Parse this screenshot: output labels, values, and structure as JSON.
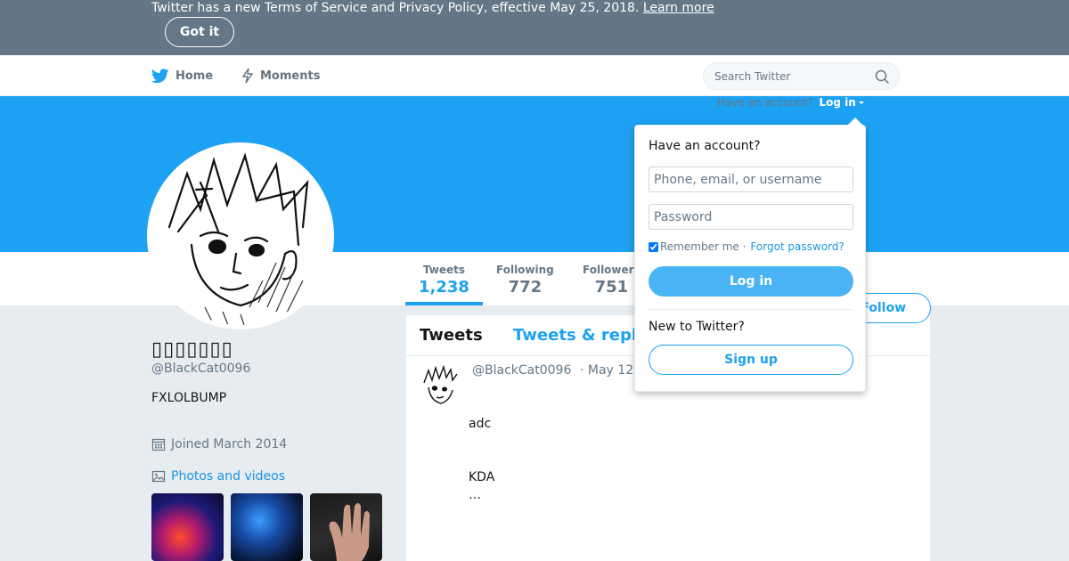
{
  "banner": {
    "text": "Twitter has a new Terms of Service and Privacy Policy, effective May 25, 2018.",
    "link": "Learn more",
    "button": "Got it"
  },
  "nav": {
    "home": "Home",
    "moments": "Moments",
    "search_placeholder": "Search Twitter"
  },
  "header": {
    "have_account": "Have an account?",
    "login_link": "Log in"
  },
  "stats": [
    {
      "label": "Tweets",
      "value": "1,238"
    },
    {
      "label": "Following",
      "value": "772"
    },
    {
      "label": "Followers",
      "value": "751"
    }
  ],
  "follow_button": "Follow",
  "profile": {
    "name": "▯▯▯▯▯▯▯",
    "handle": "@BlackCat0096",
    "bio": "FXLOLBUMP",
    "joined": "Joined March 2014",
    "photos_link": "Photos and videos"
  },
  "timeline": {
    "tab_tweets": "Tweets",
    "tab_replies": "Tweets & replies",
    "tweet": {
      "handle": "@BlackCat0096",
      "date": "· May 12",
      "lines": [
        "adc",
        "KDA",
        "…"
      ]
    }
  },
  "login_dropdown": {
    "title": "Have an account?",
    "username_placeholder": "Phone, email, or username",
    "password_placeholder": "Password",
    "remember": "Remember me ·",
    "forgot": "Forgot password?",
    "login_button": "Log in",
    "new_to": "New to Twitter?",
    "signup_button": "Sign up"
  },
  "colors": {
    "brand": "#1da1f2",
    "banner_bg": "#657786",
    "page_bg": "#e6ecf0"
  }
}
